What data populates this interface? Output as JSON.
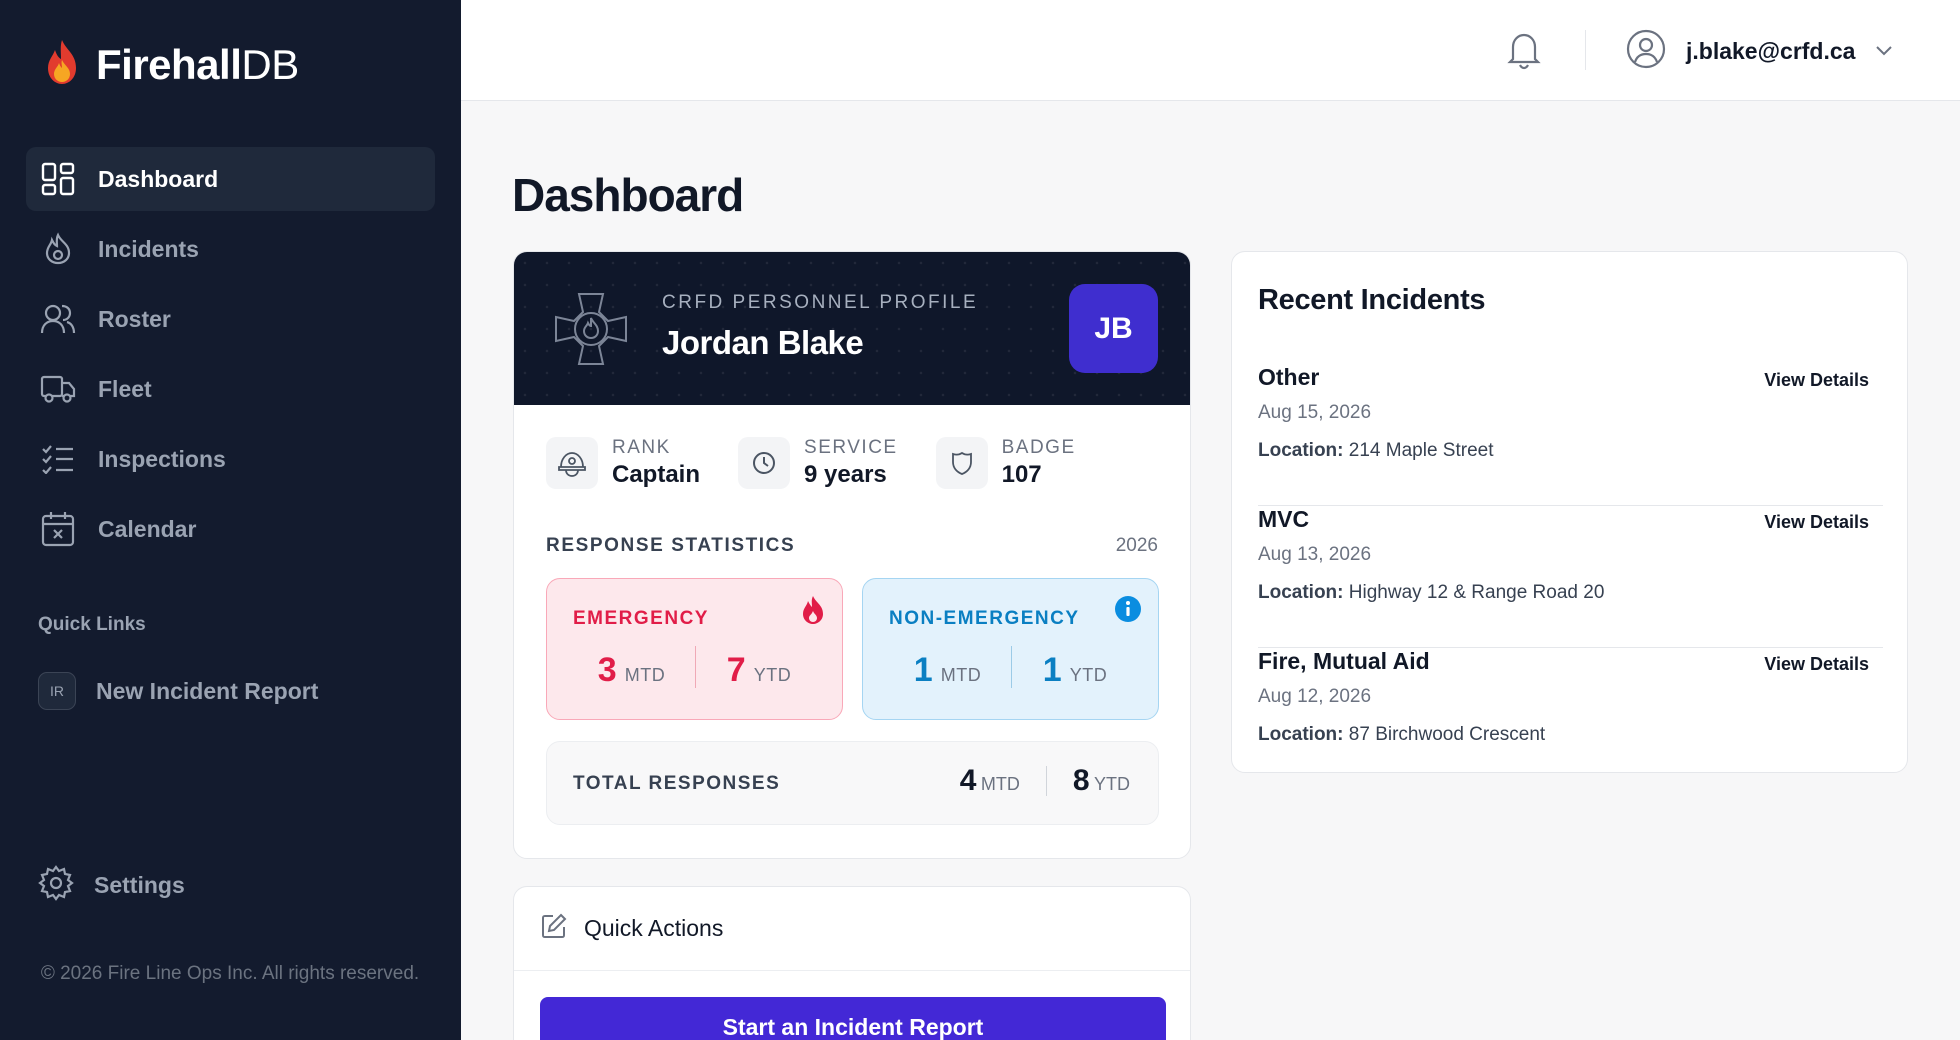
{
  "app": {
    "logo_bold": "Firehall",
    "logo_light": "DB"
  },
  "sidebar": {
    "items": [
      {
        "label": "Dashboard",
        "icon": "dashboard-icon",
        "active": true
      },
      {
        "label": "Incidents",
        "icon": "flame-icon"
      },
      {
        "label": "Roster",
        "icon": "users-icon"
      },
      {
        "label": "Fleet",
        "icon": "truck-icon"
      },
      {
        "label": "Inspections",
        "icon": "checklist-icon"
      },
      {
        "label": "Calendar",
        "icon": "calendar-icon"
      }
    ],
    "quick_links_title": "Quick Links",
    "quick_links": [
      {
        "badge": "IR",
        "label": "New Incident Report"
      }
    ],
    "settings_label": "Settings",
    "copyright": "© 2026 Fire Line Ops Inc. All rights reserved."
  },
  "header": {
    "user_email": "j.blake@crfd.ca"
  },
  "page": {
    "title": "Dashboard"
  },
  "profile": {
    "subtitle": "CRFD PERSONNEL PROFILE",
    "name": "Jordan Blake",
    "initials": "JB",
    "facts": [
      {
        "label": "RANK",
        "value": "Captain",
        "icon": "helmet-icon"
      },
      {
        "label": "SERVICE",
        "value": "9 years",
        "icon": "clock-icon"
      },
      {
        "label": "BADGE",
        "value": "107",
        "icon": "badge-icon"
      }
    ],
    "stats_title": "RESPONSE STATISTICS",
    "stats_year": "2026",
    "emergency": {
      "title": "EMERGENCY",
      "mtd": "3",
      "mtd_unit": "MTD",
      "ytd": "7",
      "ytd_unit": "YTD",
      "color": "#e11d48"
    },
    "non_emergency": {
      "title": "NON-EMERGENCY",
      "mtd": "1",
      "mtd_unit": "MTD",
      "ytd": "1",
      "ytd_unit": "YTD",
      "color": "#0a7fc2"
    },
    "total": {
      "label": "TOTAL RESPONSES",
      "mtd": "4",
      "mtd_unit": "MTD",
      "ytd": "8",
      "ytd_unit": "YTD"
    }
  },
  "quick_actions": {
    "title": "Quick Actions",
    "button": "Start an Incident Report"
  },
  "recent_incidents": {
    "title": "Recent Incidents",
    "location_label": "Location:",
    "view_label": "View Details",
    "items": [
      {
        "type": "Other",
        "date": "Aug 15, 2026",
        "location": "214 Maple Street"
      },
      {
        "type": "MVC",
        "date": "Aug 13, 2026",
        "location": "Highway 12 & Range Road 20"
      },
      {
        "type": "Fire, Mutual Aid",
        "date": "Aug 12, 2026",
        "location": "87 Birchwood Crescent"
      }
    ]
  },
  "colors": {
    "sidebar_bg": "#131b2e",
    "accent": "#4328d6",
    "emergency": "#e11d48",
    "non_emergency": "#0a7fc2"
  }
}
